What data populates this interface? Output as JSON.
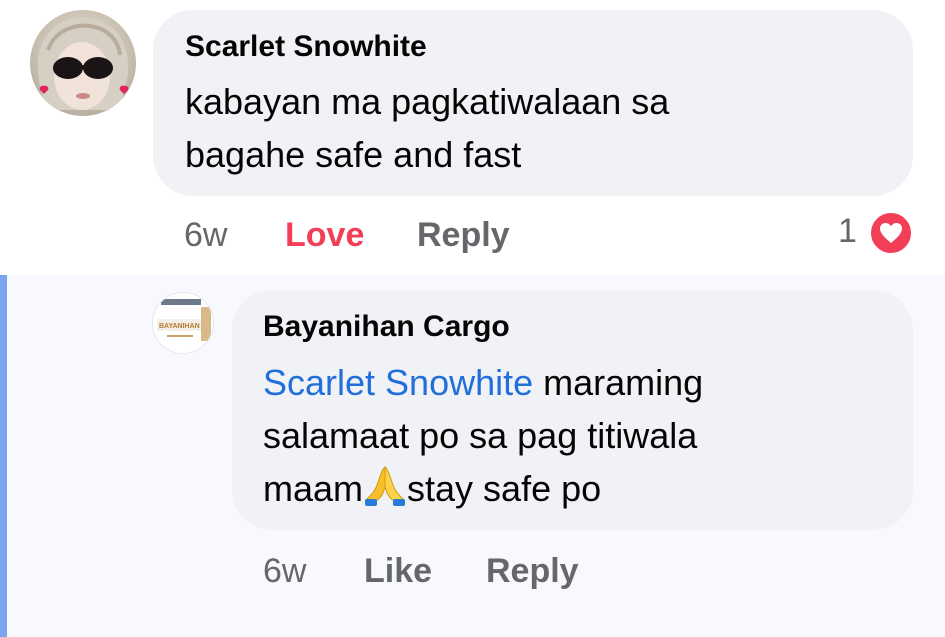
{
  "comment": {
    "author": "Scarlet Snowhite",
    "text_line1": "kabayan ma pagkatiwalaan sa",
    "text_line2": "bagahe safe and fast",
    "time": "6w",
    "reaction_action": "Love",
    "reply_action": "Reply",
    "reaction_count": "1",
    "reaction_icon": "heart-icon",
    "reaction_color": "#f33e58"
  },
  "reply": {
    "author": "Bayanihan Cargo",
    "mention": "Scarlet Snowhite",
    "text_line1_rest": " maraming",
    "text_line2": "salamaat po sa pag titiwala",
    "text_line3_start": "maam",
    "emoji": "folded-hands-icon",
    "text_line3_end": "stay safe po",
    "time": "6w",
    "like_action": "Like",
    "reply_action": "Reply",
    "avatar_text": "BAYANIHAN"
  },
  "colors": {
    "bubble": "#f0f2f5",
    "mention": "#216fdb",
    "meta": "#65676b",
    "love": "#f33e58",
    "reply_rail": "#7aa3f0"
  }
}
